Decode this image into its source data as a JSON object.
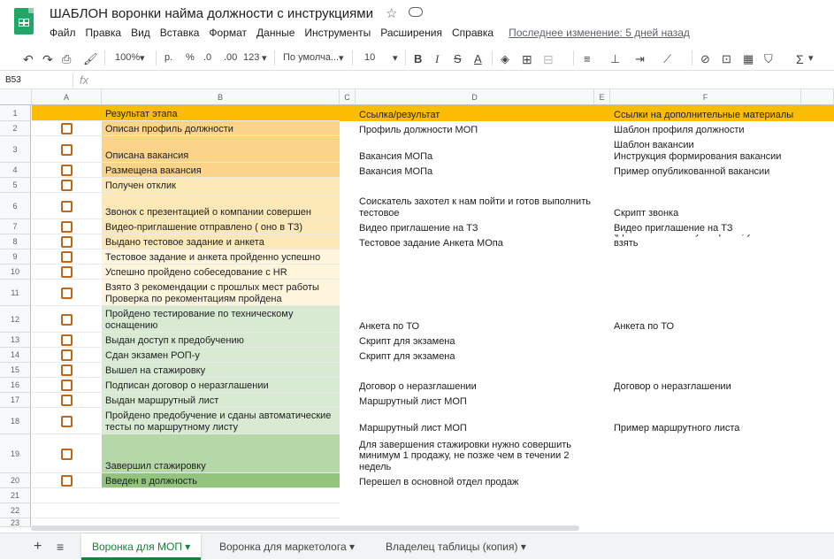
{
  "doc_title": "ШАБЛОН воронки найма должности с инструкциями",
  "menu": [
    "Файл",
    "Правка",
    "Вид",
    "Вставка",
    "Формат",
    "Данные",
    "Инструменты",
    "Расширения",
    "Справка"
  ],
  "last_edit": "Последнее изменение: 5 дней назад",
  "toolbar": {
    "zoom": "100%",
    "currency": "р.",
    "percent": "%",
    "dec_dec": ".0",
    "dec_inc": ".00",
    "format": "123",
    "font": "По умолча...",
    "size": "10"
  },
  "name_box": "B53",
  "fx": "fx",
  "columns": [
    "A",
    "B",
    "C",
    "D",
    "E",
    "F"
  ],
  "colors": {
    "header": "#fbbc04",
    "orange": "#fbd389",
    "light_orange": "#fde8b8",
    "light_yellow": "#fef5dc",
    "green": "#d9ead3",
    "green_mid": "#b6d7a8",
    "green_dark": "#93c47d",
    "checkbox": "#c0661c"
  },
  "rows": [
    {
      "num": "1",
      "b": "Результат этапа",
      "d": "Ссылка/результат",
      "f": "Ссылки на дополнительные материалы",
      "cb": false
    },
    {
      "num": "2",
      "b": "Описан профиль должности",
      "d": "Профиль должности МОП",
      "f": "Шаблон профиля должности",
      "cb": true
    },
    {
      "num": "3",
      "b": "Описана вакансия",
      "d": "Вакансия МОПа",
      "f": "Шаблон вакансии\nИнструкция формирования вакансии",
      "cb": true
    },
    {
      "num": "4",
      "b": "Размещена вакансия",
      "d": "Вакансия МОПа",
      "f": "Пример опубликованной вакансии",
      "cb": true
    },
    {
      "num": "5",
      "b": "Получен отклик",
      "d": "",
      "f": "",
      "cb": true
    },
    {
      "num": "6",
      "b": "Звонок с презентацией о компании совершен",
      "d": "Соискатель захотел к нам пойти и готов выполнить\nтестовое",
      "f": "Скрипт звонка",
      "cb": true
    },
    {
      "num": "7",
      "b": "Видео-приглашение отправлено ( оно в  ТЗ)",
      "d": "Видео приглашение на ТЗ",
      "f": "Видео приглашение на ТЗ",
      "cb": true
    },
    {
      "num": "8",
      "b": "Выдано тестовое задание и анкета",
      "d": "Тестовое задание   Анкета МОпа",
      "f": "(Добавить в анкету вопросы, у кого взять",
      "cb": true
    },
    {
      "num": "9",
      "b": "Тестовое задание и анкета пройденно успешно",
      "d": "",
      "f": "",
      "cb": true
    },
    {
      "num": "10",
      "b": "Успешно пройдено собеседование с HR",
      "d": "",
      "f": "",
      "cb": true
    },
    {
      "num": "11",
      "b": "Взято 3 рекомендации с прошлых мест работы\nПроверка по рекоментациям пройдена",
      "d": "",
      "f": "",
      "cb": true
    },
    {
      "num": "12",
      "b": "Пройдено тестирование по техническому\nоснащению",
      "d": "Анкета по ТО",
      "f": "Анкета по ТО",
      "cb": true
    },
    {
      "num": "13",
      "b": "Выдан доступ к предобучению",
      "d": "Скрипт для экзамена",
      "f": "",
      "cb": true
    },
    {
      "num": "14",
      "b": "Сдан экзамен РОП-у",
      "d": "Скрипт для экзамена",
      "f": "",
      "cb": true
    },
    {
      "num": "15",
      "b": "Вышел на стажировку",
      "d": "",
      "f": "",
      "cb": true
    },
    {
      "num": "16",
      "b": "Подписан договор о неразглашении",
      "d": "Договор о неразглашении",
      "f": "Договор о неразглашении",
      "cb": true
    },
    {
      "num": "17",
      "b": "Выдан маршрутный лист",
      "d": "Маршрутный лист МОП",
      "f": "",
      "cb": true
    },
    {
      "num": "18",
      "b": "Пройдено предобучение и сданы автоматические\nтесты по маршрутному листу",
      "d": "Маршрутный лист МОП",
      "f": "Пример маршрутного листа",
      "cb": true
    },
    {
      "num": "19",
      "b": "Завершил стажировку",
      "d": "Для завершения стажировки нужно совершить\nминимум 1 продажу, не позже чем в течении 2\nнедель",
      "f": "",
      "cb": true
    },
    {
      "num": "20",
      "b": "Введен в должность",
      "d": "Перешел в основной отдел продаж",
      "f": "",
      "cb": true
    },
    {
      "num": "21",
      "b": "",
      "d": "",
      "f": "",
      "cb": false
    },
    {
      "num": "22",
      "b": "",
      "d": "",
      "f": "",
      "cb": false
    },
    {
      "num": "23",
      "b": "",
      "d": "",
      "f": "",
      "cb": false
    }
  ],
  "sheet_tabs": [
    "Воронка для МОП",
    "Воронка для маркетолога",
    "Владелец таблицы (копия)"
  ]
}
